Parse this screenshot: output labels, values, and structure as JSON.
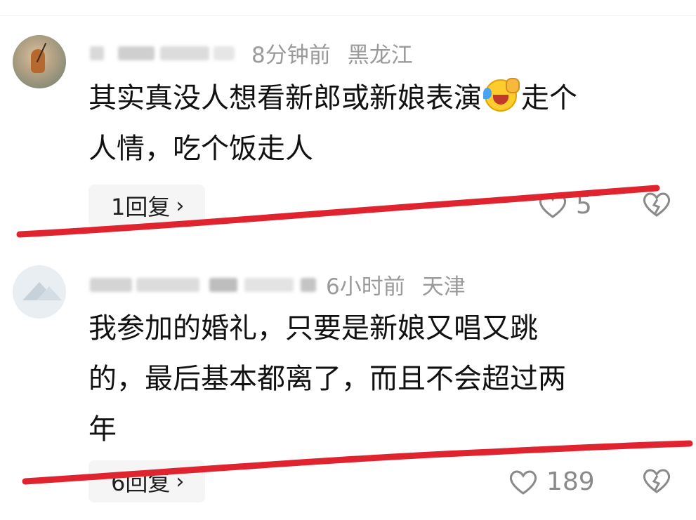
{
  "comments": [
    {
      "time": "8分钟前",
      "location": "黑龙江",
      "text_line1": "其实真没人想看新郎或新娘表演",
      "text_after_emoji": "走个",
      "text_line2": "人情，吃个饭走人",
      "emoji": "crying-laughing-emoji",
      "reply_label": "1回复",
      "likes": "5"
    },
    {
      "time": "6小时前",
      "location": "天津",
      "text_line1": "我参加的婚礼，只要是新娘又唱又跳",
      "text_line2": "的，最后基本都离了，而且不会超过两",
      "text_line3": "年",
      "reply_label": "6回复",
      "likes": "189"
    }
  ],
  "icons": {
    "like": "heart-icon",
    "dislike": "broken-heart-icon",
    "chevron": "chevron-right-icon"
  },
  "colors": {
    "annotation_stroke": "#e0242f",
    "meta_text": "#9a9a9a",
    "body_text": "#111111"
  }
}
